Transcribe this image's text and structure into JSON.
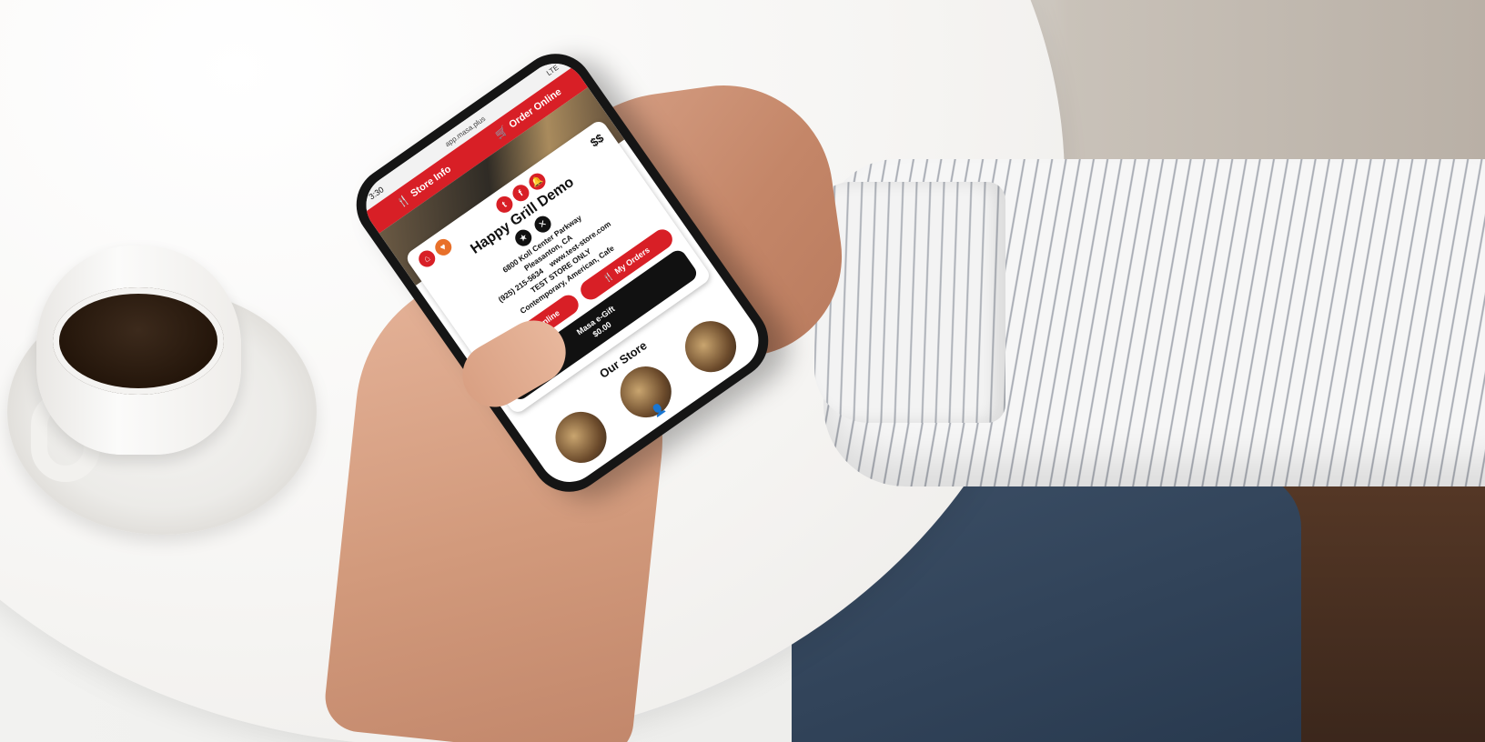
{
  "status_bar": {
    "time": "3:30",
    "url": "app.masa.plus",
    "signal": "LTE"
  },
  "top_nav": {
    "store_info": "Store Info",
    "order_online": "Order Online"
  },
  "store": {
    "name": "Happy Grill Demo",
    "price_level": "$$",
    "address_line1": "6800 Koll Center Parkway",
    "address_line2": "Pleasanton, CA",
    "phone": "(925) 215-5634",
    "website": "www.test-store.com",
    "note": "TEST STORE ONLY",
    "cuisine": "Contemporary, American, Cafe"
  },
  "buttons": {
    "order_online": "Order Online",
    "my_orders": "My Orders"
  },
  "gift": {
    "label": "Masa e-Gift",
    "value": "$0.00"
  },
  "section": {
    "our_store": "Our Store"
  },
  "colors": {
    "brand_red": "#d81f26",
    "dark": "#111111"
  },
  "icons": {
    "social": [
      "twitter-icon",
      "facebook-icon",
      "notification-icon"
    ],
    "left": [
      "home-icon",
      "heart-icon"
    ],
    "badges": [
      "award-icon",
      "utensils-icon"
    ]
  }
}
